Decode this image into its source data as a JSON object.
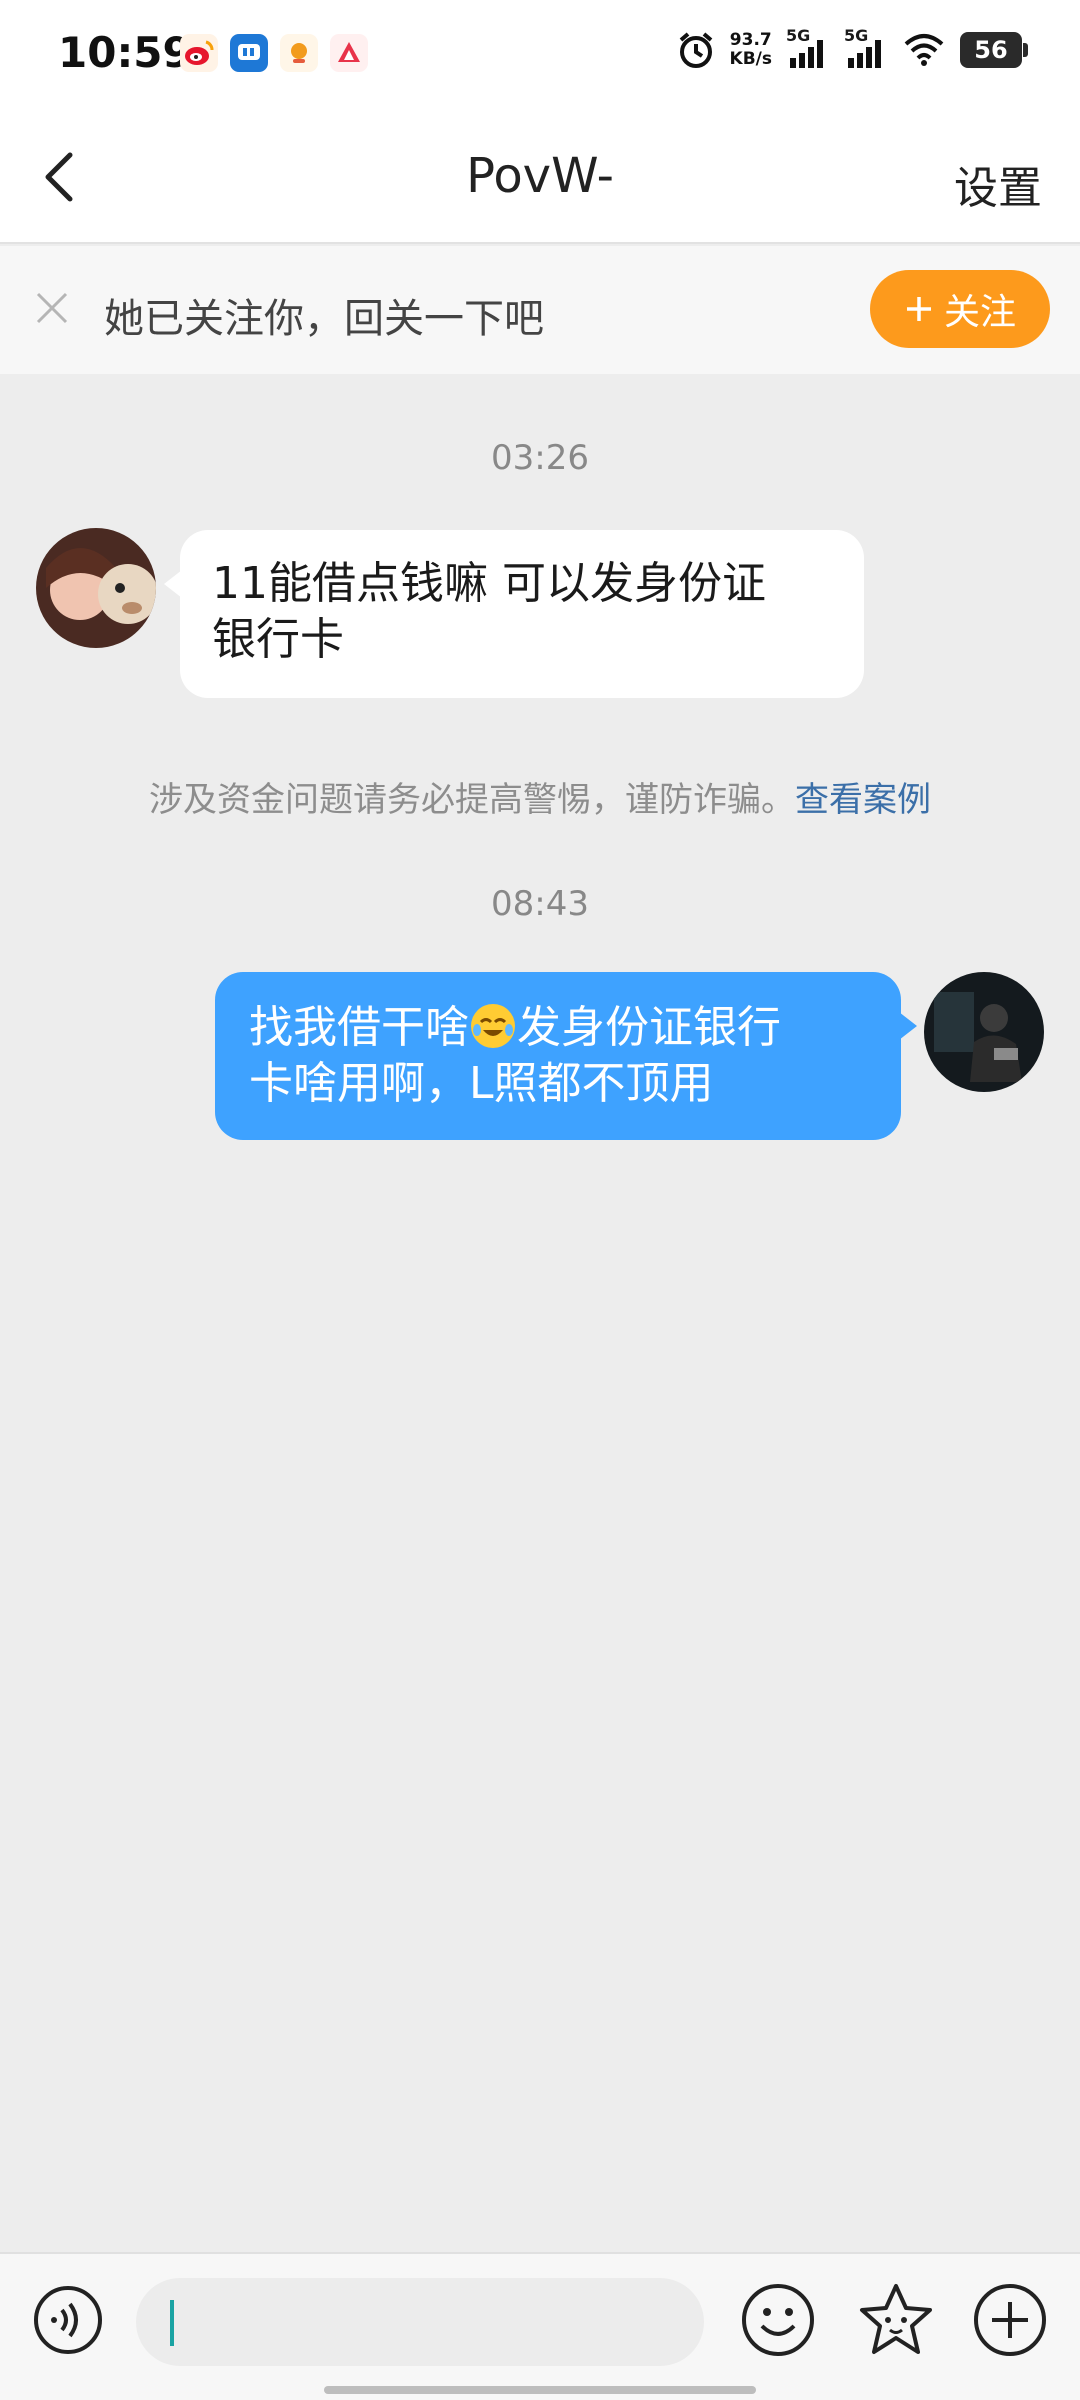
{
  "status_bar": {
    "time": "10:59",
    "net_speed_value": "93.7",
    "net_speed_unit": "KB/s",
    "signal1": "5G",
    "signal2": "5G",
    "battery": "56"
  },
  "header": {
    "title": "PovW-",
    "settings_label": "设置"
  },
  "follow_banner": {
    "text": "她已关注你，回关一下吧",
    "follow_button": "关注"
  },
  "messages": [
    {
      "timestamp": "03:26"
    },
    {
      "text_line1": "11能借点钱嘛 可以发身份证",
      "text_line2": "银行卡"
    },
    {
      "warning": "涉及资金问题请务必提高警惕，谨防诈骗。",
      "warning_link": "查看案例"
    },
    {
      "timestamp": "08:43"
    },
    {
      "text_part1": "找我借干啥",
      "text_part2": "发身份证银行",
      "text_line2": "卡啥用啊，L照都不顶用"
    }
  ],
  "colors": {
    "accent_orange": "#fd9a1c",
    "outgoing_bubble": "#3ea2ff",
    "link_blue": "#3b6fa8",
    "chat_background": "#ededed"
  },
  "icons": {
    "back": "chevron-left-icon",
    "close": "close-icon",
    "voice": "voice-icon",
    "emoji": "smiley-icon",
    "sticker": "sticker-icon",
    "plus": "plus-icon"
  }
}
